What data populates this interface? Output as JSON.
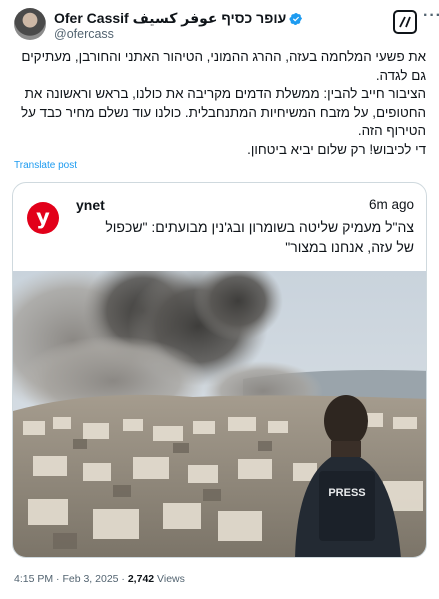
{
  "author": {
    "display_name": "Ofer Cassif עופר כסיף عوفر كسيف",
    "handle": "@ofercass",
    "avatar_icon": "profile-photo",
    "verified_icon": "verified-badge-icon"
  },
  "tweet": {
    "paragraphs": [
      "את פשעי המלחמה בעזה, ההרג ההמוני, הטיהור האתני והחורבן, מעתיקים גם לגדה.",
      "הציבור חייב להבין: ממשלת הדמים מקריבה את כולנו, בראש וראשונה את החטופים, על מזבח המשיחיות המתנחבלית. כולנו עוד נשלם מחיר כבד על הטירוף הזה.",
      "די לכיבוש! רק שלום יביא ביטחון."
    ],
    "translate_label": "Translate post"
  },
  "card": {
    "logo_letter": "y",
    "source": "ynet",
    "time_ago": "6m ago",
    "headline": "צה\"ל מעמיק שליטה בשומרון ובג'נין מבועתים: \"שכפול של עזה, אנחנו במצור\"",
    "photo_vest_label": "PRESS"
  },
  "meta": {
    "time": "4:15 PM",
    "date": "Feb 3, 2025",
    "views_count": "2,742",
    "views_label": "Views"
  },
  "colors": {
    "accent": "#1d9bf0",
    "ynet_red": "#e2001a",
    "text": "#0f1419",
    "secondary": "#536471",
    "border": "#cfd9de"
  }
}
